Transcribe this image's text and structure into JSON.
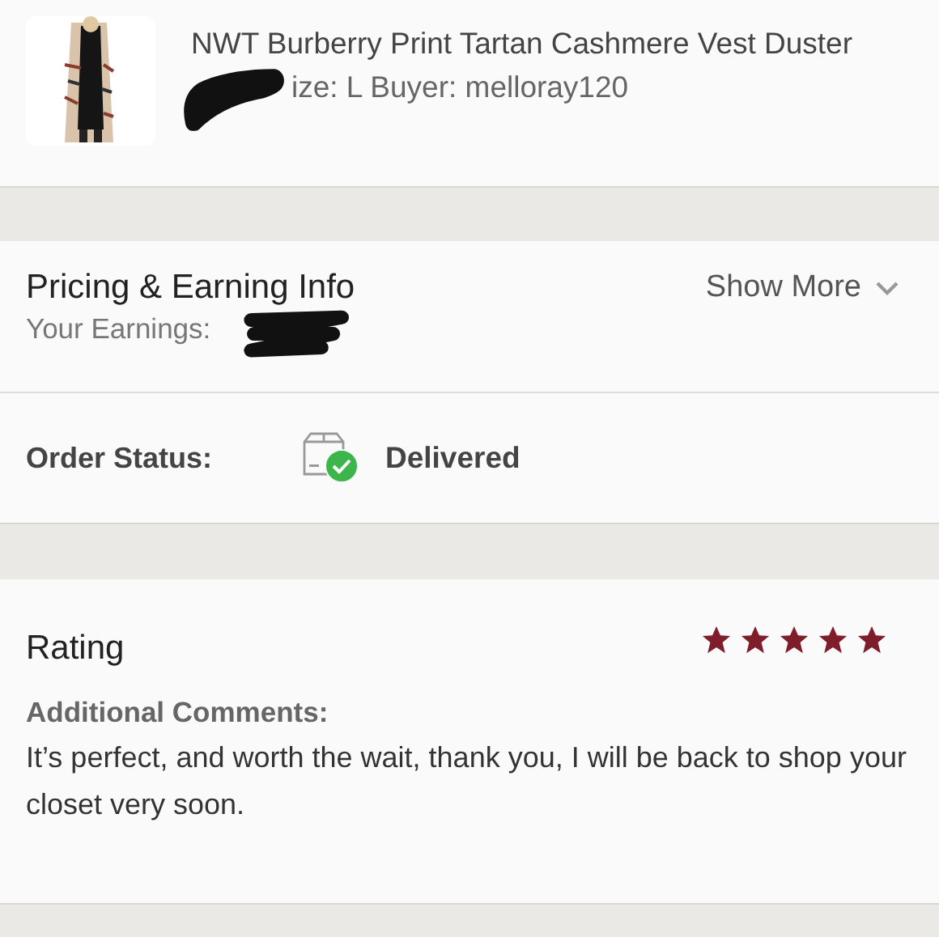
{
  "item": {
    "kind": "picture",
    "title": "NWT Burberry Print Tartan Cashmere Vest Duster",
    "details": "ize: L  Buyer: melloray120"
  },
  "pricing": {
    "title": "Pricing & Earning Info",
    "earnings_label": "Your Earnings:",
    "toggle": "Show More",
    "expanded": false
  },
  "order_status": {
    "label": "Order Status:",
    "value": "Delivered",
    "delivered": true
  },
  "rating": {
    "title": "Rating",
    "stars": 5,
    "comments_label": "Additional Comments:",
    "comments": "It’s perfect, and worth the wait, thank you, I will be back to shop your closet very soon."
  }
}
